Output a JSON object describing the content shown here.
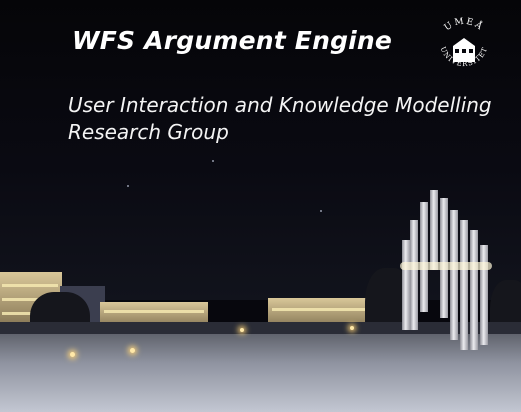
{
  "header": {
    "title": "WFS Argument Engine",
    "subtitle_line1": "User Interaction and Knowledge Modelling",
    "subtitle_line2": "Research Group"
  },
  "logo": {
    "top_text": "UMEÅ",
    "side_text": "UNIVERSITET",
    "icon": "university-seal-icon"
  },
  "colors": {
    "sky": "#07070d",
    "text": "#ffffff",
    "snow": "#c3c7d2",
    "lights": "#ffe8a8"
  }
}
